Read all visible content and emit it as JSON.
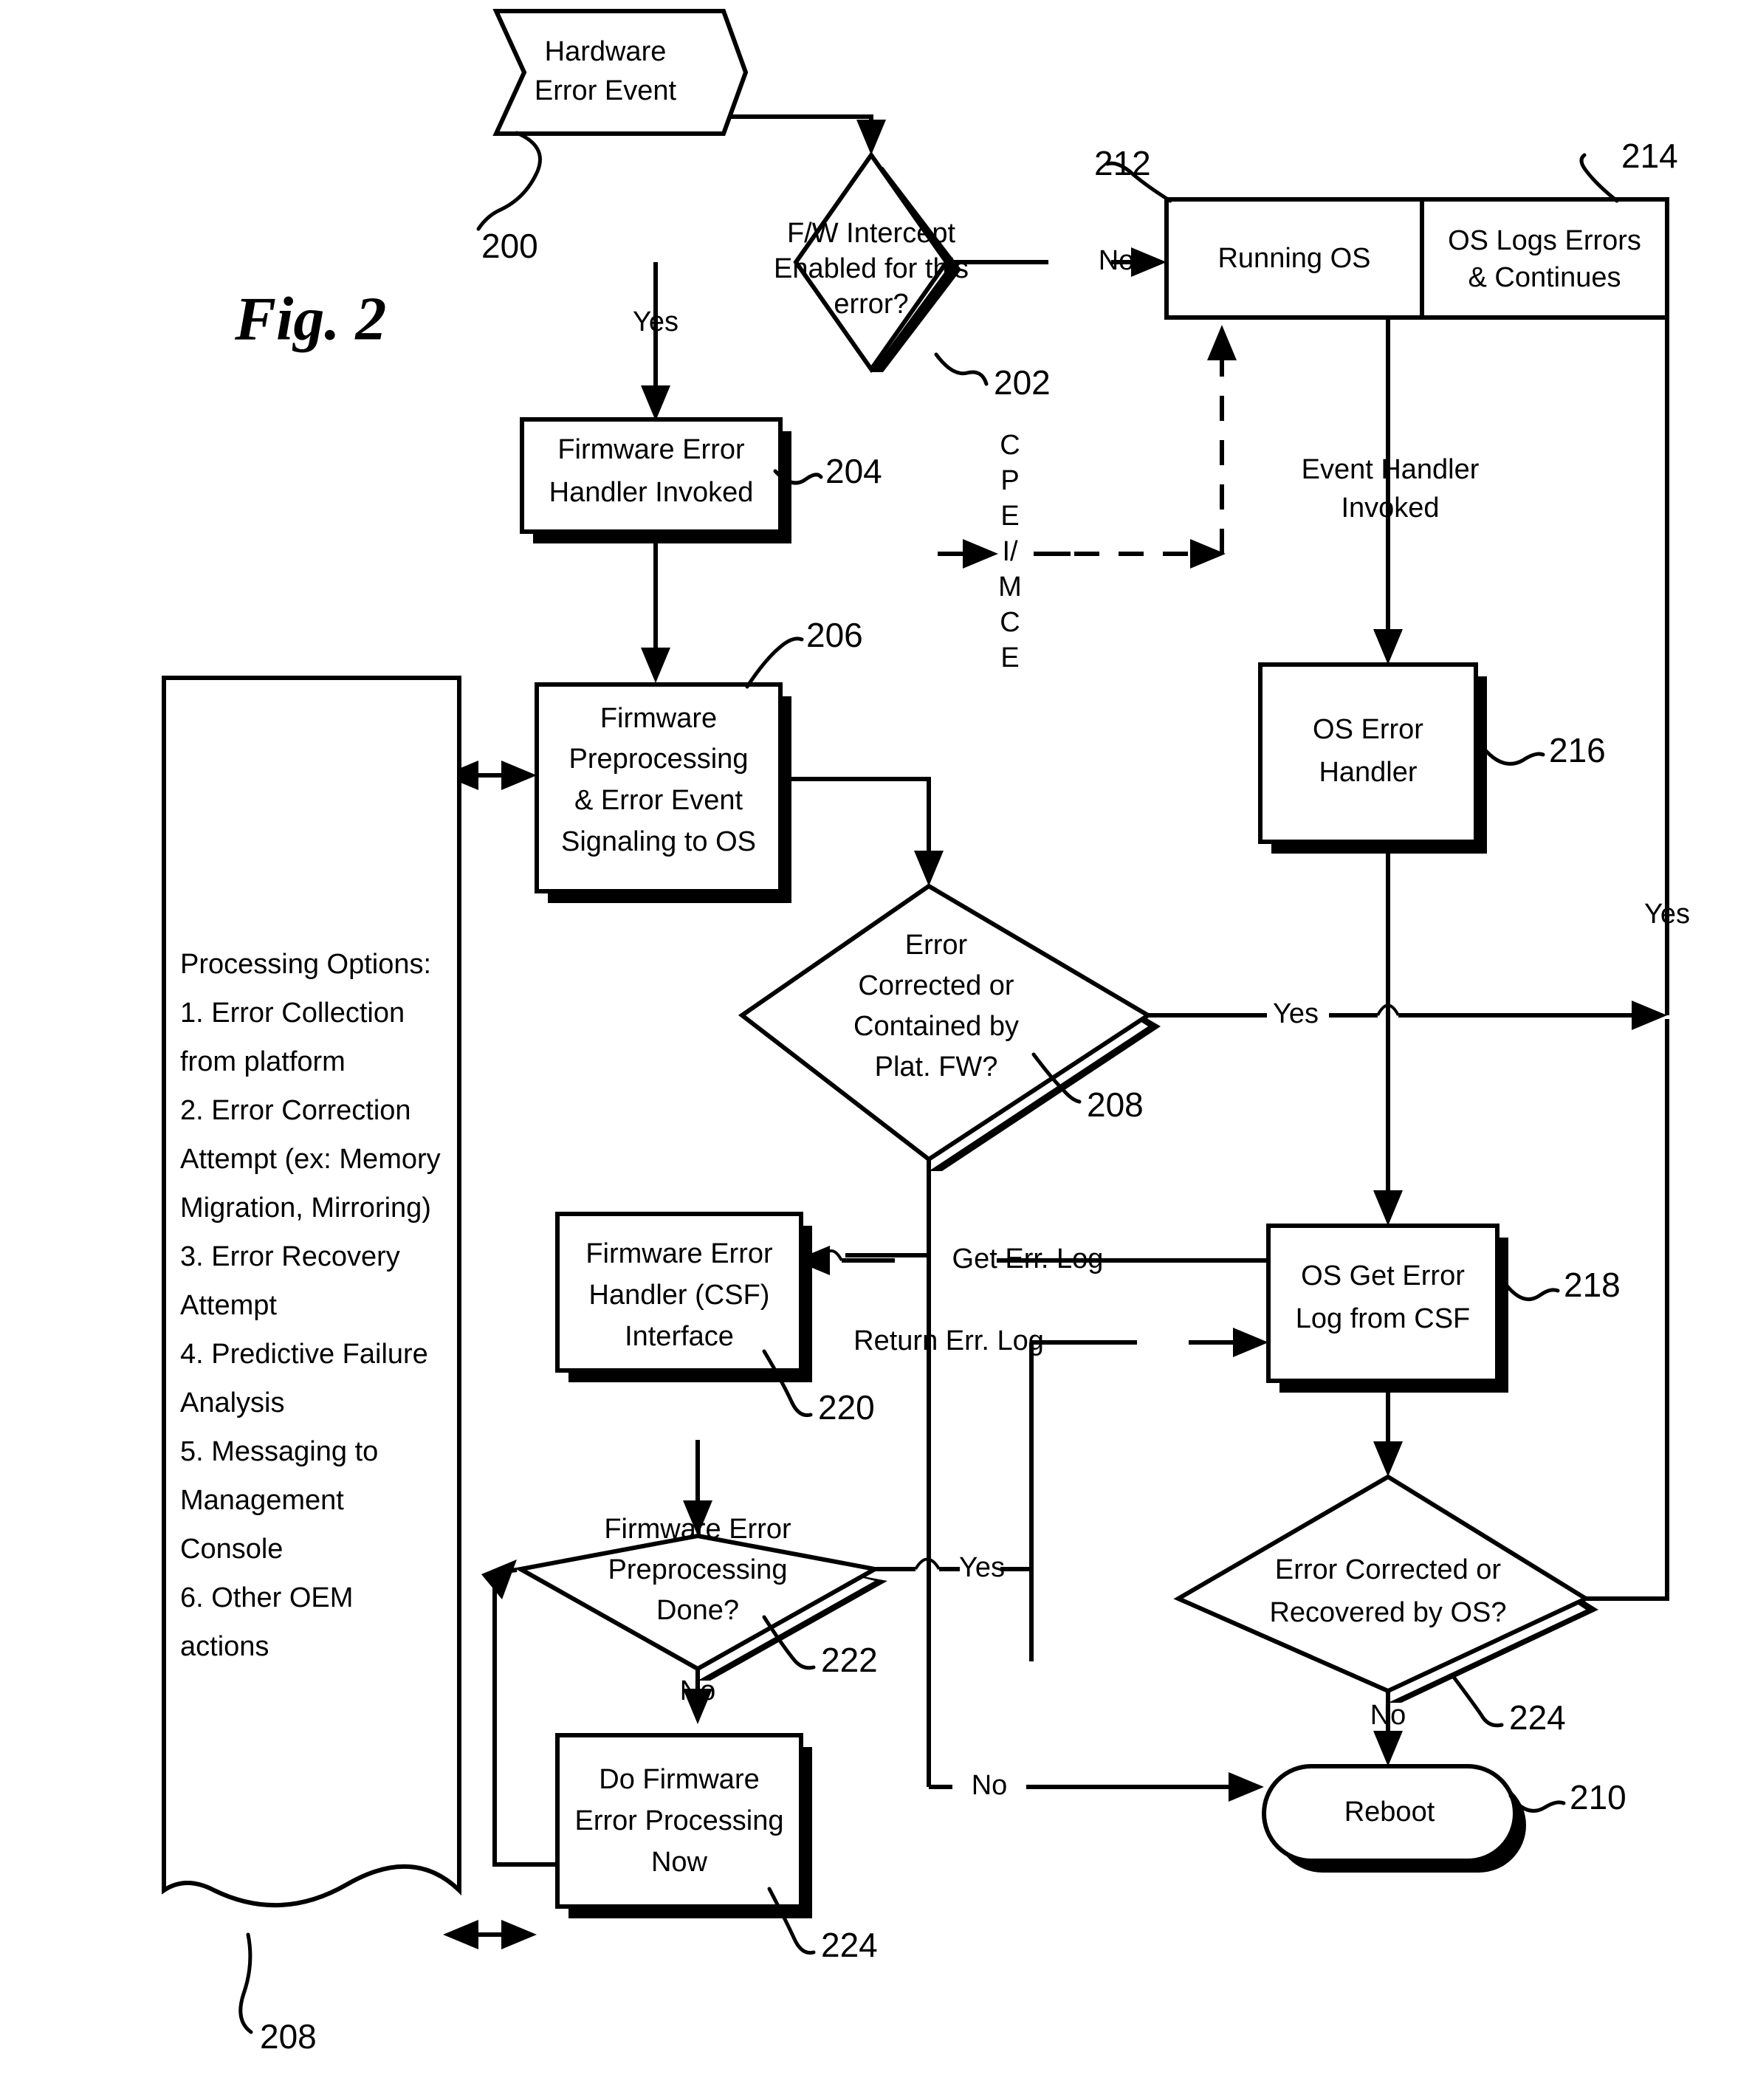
{
  "figure": {
    "title": "Fig. 2"
  },
  "nodes": {
    "start": {
      "id": "200",
      "shape": "chevron-terminator",
      "lines": [
        "Hardware",
        "Error Event"
      ]
    },
    "fw_intercept": {
      "id": "202",
      "shape": "decision",
      "lines": [
        "F/W Intercept",
        "Enabled for this",
        "error?"
      ]
    },
    "fw_handler_invoked": {
      "id": "204",
      "shape": "process",
      "lines": [
        "Firmware Error",
        "Handler Invoked"
      ]
    },
    "fw_preprocessing": {
      "id": "206",
      "shape": "process",
      "lines": [
        "Firmware",
        "Preprocessing",
        "& Error Event",
        "Signaling to OS"
      ]
    },
    "error_corrected_fw": {
      "id": "208",
      "shape": "decision",
      "lines": [
        "Error",
        "Corrected or",
        "Contained  by",
        "Plat. FW?"
      ]
    },
    "reboot": {
      "id": "210",
      "shape": "terminator",
      "lines": [
        "Reboot"
      ]
    },
    "running_os": {
      "id": "212",
      "shape": "process",
      "lines": [
        "Running OS"
      ]
    },
    "os_logs_errors": {
      "id": "214",
      "shape": "process",
      "lines": [
        "OS Logs Errors",
        "& Continues"
      ]
    },
    "os_error_handler": {
      "id": "216",
      "shape": "process",
      "lines": [
        "OS  Error",
        "Handler"
      ]
    },
    "os_get_error_log": {
      "id": "218",
      "shape": "process",
      "lines": [
        "OS Get Error",
        "Log from CSF"
      ]
    },
    "fw_error_handler_csf": {
      "id": "220",
      "shape": "process",
      "lines": [
        "Firmware Error",
        "Handler (CSF)",
        "Interface"
      ]
    },
    "fw_preprocessing_done": {
      "id": "222",
      "shape": "decision",
      "lines": [
        "Firmware Error",
        "Preprocessing",
        "Done?"
      ]
    },
    "error_corrected_os": {
      "id": "224",
      "shape": "decision",
      "lines": [
        "Error Corrected or",
        "Recovered by OS?"
      ]
    },
    "do_fw_error_processing": {
      "id": "224",
      "shape": "process",
      "lines": [
        "Do Firmware",
        "Error Processing",
        "Now"
      ]
    },
    "processing_options": {
      "id": "208",
      "shape": "note-torn",
      "lines": [
        "Processing Options:",
        "1. Error Collection",
        "from platform",
        "2. Error Correction",
        "Attempt (ex: Memory",
        "Migration, Mirroring)",
        "3. Error Recovery",
        "Attempt",
        "4. Predictive Failure",
        "Analysis",
        "5. Messaging to",
        "Management",
        "Console",
        "6. Other OEM",
        "actions"
      ]
    }
  },
  "edge_labels": {
    "intercept_yes": "Yes",
    "intercept_no": "No",
    "cpe_mce": [
      "C",
      "P",
      "E",
      "I/",
      "M",
      "C",
      "E"
    ],
    "event_handler_invoked": [
      "Event Handler",
      "Invoked"
    ],
    "fw_corrected_yes": "Yes",
    "right_yes": "Yes",
    "get_err_log": "Get Err. Log",
    "return_err_log": "Return Err. Log",
    "preproc_done_yes": "Yes",
    "preproc_done_no": "No",
    "os_recovered_no": "No",
    "to_reboot_no": "No"
  },
  "ref_numbers": {
    "n200": "200",
    "n202": "202",
    "n204": "204",
    "n206": "206",
    "n208_diamond": "208",
    "n208_note": "208",
    "n210": "210",
    "n212": "212",
    "n214": "214",
    "n216": "216",
    "n218": "218",
    "n220": "220",
    "n222": "222",
    "n224_diamond": "224",
    "n224_box": "224"
  },
  "colors": {
    "ink": "#000000",
    "paper": "#ffffff"
  }
}
